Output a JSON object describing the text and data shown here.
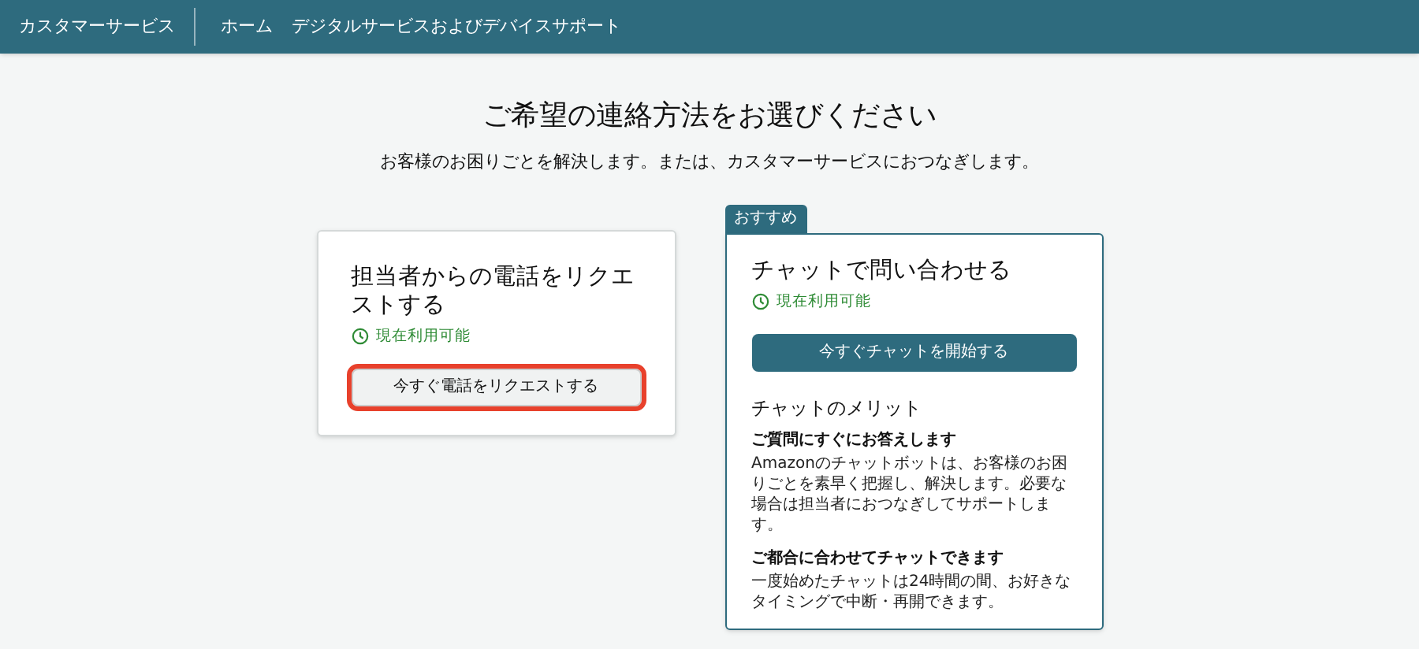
{
  "nav": {
    "brand": "カスタマーサービス",
    "links": [
      "ホーム",
      "デジタルサービスおよびデバイスサポート"
    ]
  },
  "heading": "ご希望の連絡方法をお選びください",
  "subheading": "お客様のお困りごとを解決します。または、カスタマーサービスにおつなぎします。",
  "options": [
    {
      "title": "担当者からの電話をリクエストする",
      "availability": "現在利用可能",
      "button": "今すぐ電話をリクエストする",
      "recommended": false,
      "highlighted": true,
      "primary": false
    },
    {
      "badge": "おすすめ",
      "title": "チャットで問い合わせる",
      "availability": "現在利用可能",
      "button": "今すぐチャットを開始する",
      "recommended": true,
      "highlighted": false,
      "primary": true,
      "benefits_title": "チャットのメリット",
      "benefits": [
        {
          "heading": "ご質問にすぐにお答えします",
          "text": "Amazonのチャットボットは、お客様のお困りごとを素早く把握し、解決します。必要な場合は担当者におつなぎしてサポートします。"
        },
        {
          "heading": "ご都合に合わせてチャットできます",
          "text": "一度始めたチャットは24時間の間、お好きなタイミングで中断・再開できます。"
        }
      ]
    }
  ]
}
